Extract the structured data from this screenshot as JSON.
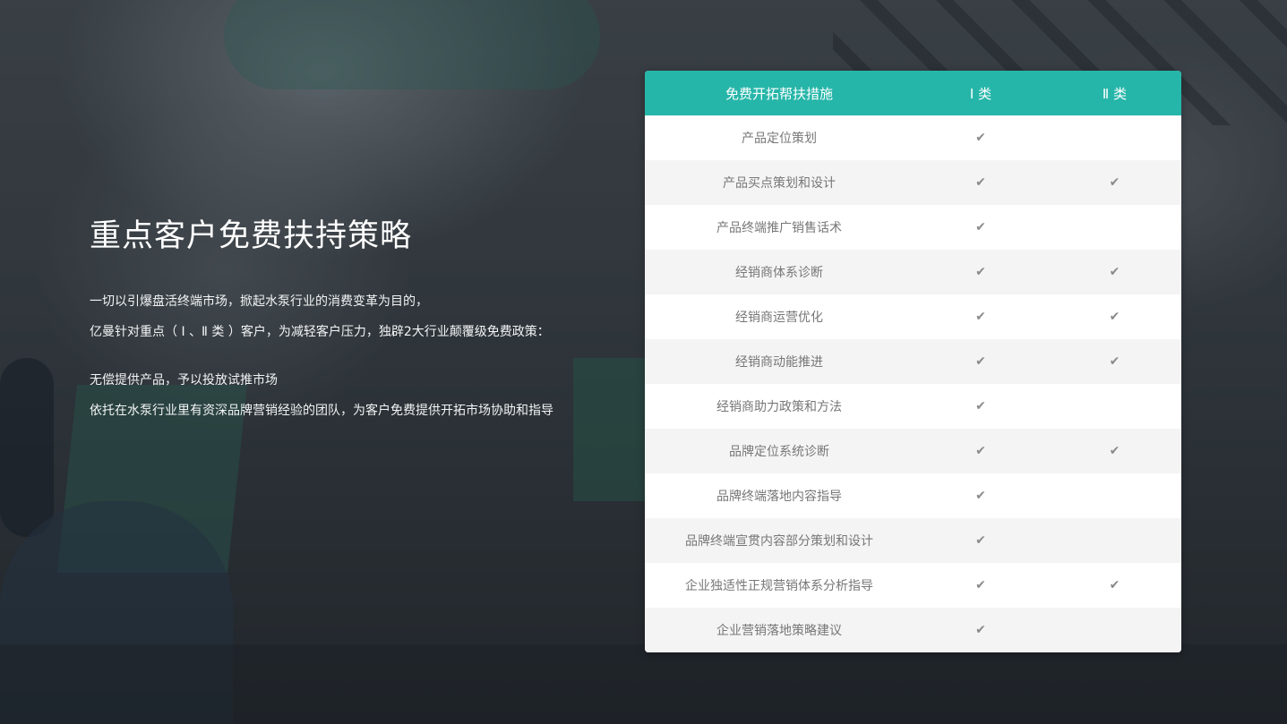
{
  "intro": {
    "title": "重点客户免费扶持策略",
    "lines": [
      "一切以引爆盘活终端市场，掀起水泵行业的消费变革为目的，",
      "亿曼针对重点（ Ⅰ 、Ⅱ 类 ）客户，为减轻客户压力，独辟2大行业颠覆级免费政策：",
      "无偿提供产品，予以投放试推市场",
      "依托在水泵行业里有资深品牌营销经验的团队，为客户免费提供开拓市场协助和指导"
    ]
  },
  "table": {
    "headers": [
      "免费开拓帮扶措施",
      "Ⅰ 类",
      "Ⅱ 类"
    ],
    "check_glyph": "✔",
    "rows": [
      {
        "label": "产品定位策划",
        "c1": "✔",
        "c2": ""
      },
      {
        "label": "产品买点策划和设计",
        "c1": "✔",
        "c2": "✔"
      },
      {
        "label": "产品终端推广销售话术",
        "c1": "✔",
        "c2": ""
      },
      {
        "label": "经销商体系诊断",
        "c1": "✔",
        "c2": "✔"
      },
      {
        "label": "经销商运营优化",
        "c1": "✔",
        "c2": "✔"
      },
      {
        "label": "经销商动能推进",
        "c1": "✔",
        "c2": "✔"
      },
      {
        "label": "经销商助力政策和方法",
        "c1": "✔",
        "c2": ""
      },
      {
        "label": "品牌定位系统诊断",
        "c1": "✔",
        "c2": "✔"
      },
      {
        "label": "品牌终端落地内容指导",
        "c1": "✔",
        "c2": ""
      },
      {
        "label": "品牌终端宣贯内容部分策划和设计",
        "c1": "✔",
        "c2": ""
      },
      {
        "label": "企业独适性正规营销体系分析指导",
        "c1": "✔",
        "c2": "✔"
      },
      {
        "label": "企业营销落地策略建议",
        "c1": "✔",
        "c2": ""
      }
    ]
  },
  "colors": {
    "header_bg": "#26b6a9",
    "row_alt_bg": "#f4f4f4",
    "text_gray": "#777777"
  }
}
